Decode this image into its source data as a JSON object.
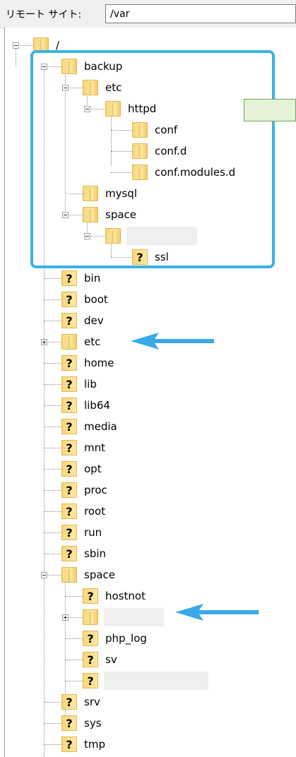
{
  "remote_site": {
    "label": "リモート サイト:",
    "path": "/var"
  },
  "tree": {
    "root": "/",
    "backup_folder": "backup",
    "backup_children": {
      "etc": "etc",
      "httpd": "httpd",
      "conf": "conf",
      "conf_d": "conf.d",
      "conf_modules_d": "conf.modules.d",
      "mysql": "mysql",
      "space": "space",
      "ssl": "ssl"
    },
    "root_items": {
      "bin": "bin",
      "boot": "boot",
      "dev": "dev",
      "etc": "etc",
      "home": "home",
      "lib": "lib",
      "lib64": "lib64",
      "media": "media",
      "mnt": "mnt",
      "opt": "opt",
      "proc": "proc",
      "root": "root",
      "run": "run",
      "sbin": "sbin",
      "space": "space",
      "srv": "srv",
      "sys": "sys",
      "tmp": "tmp"
    },
    "space_children": {
      "hostnot": "hostnot",
      "php_log": "php_log",
      "sv": "sv"
    }
  },
  "unknown_glyph": "?",
  "annotation_colors": {
    "highlight": "#3ab2e3",
    "arrow": "#3aa9e8",
    "note_box": "#e4f2d7"
  }
}
